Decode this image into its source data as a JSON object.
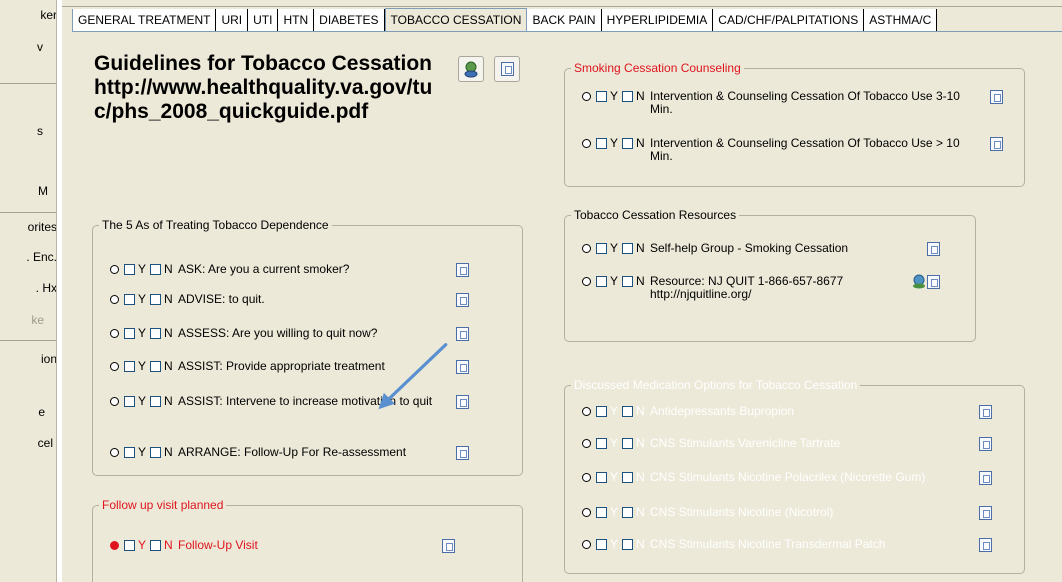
{
  "sidebar": {
    "items": [
      {
        "label": "ker",
        "disabled": false
      },
      {
        "label": "v",
        "disabled": false
      },
      {
        "label": "s",
        "disabled": false
      },
      {
        "label": "M",
        "disabled": false
      },
      {
        "label": "orites",
        "disabled": false
      },
      {
        "label": ". Enc.",
        "disabled": false
      },
      {
        "label": ". Hx",
        "disabled": false
      },
      {
        "label": "ke",
        "disabled": true
      },
      {
        "label": "ion",
        "disabled": false
      },
      {
        "label": "e",
        "disabled": false
      },
      {
        "label": "cel",
        "disabled": false
      }
    ]
  },
  "tabs": [
    {
      "label": "GENERAL TREATMENT",
      "active": false
    },
    {
      "label": "URI",
      "active": false
    },
    {
      "label": "UTI",
      "active": false
    },
    {
      "label": "HTN",
      "active": false
    },
    {
      "label": "DIABETES",
      "active": false
    },
    {
      "label": "TOBACCO CESSATION",
      "active": true
    },
    {
      "label": "BACK PAIN",
      "active": false
    },
    {
      "label": "HYPERLIPIDEMIA",
      "active": false
    },
    {
      "label": "CAD/CHF/PALPITATIONS",
      "active": false
    },
    {
      "label": "ASTHMA/C",
      "active": false
    }
  ],
  "title": "Guidelines for Tobacco Cessation http://www.healthquality.va.gov/tuc/phs_2008_quickguide.pdf",
  "yes_label": "Y",
  "no_label": "N",
  "five_as": {
    "legend": "The 5 As of Treating Tobacco Dependence",
    "items": [
      "ASK: Are you a current smoker?",
      "ADVISE: to quit.",
      "ASSESS: Are you willing to quit now?",
      "ASSIST: Provide appropriate treatment",
      "ASSIST: Intervene to increase motivation to quit",
      "ARRANGE: Follow-Up For Re-assessment"
    ]
  },
  "followup": {
    "legend": "Follow up visit planned",
    "item": "Follow-Up Visit"
  },
  "counseling": {
    "legend": "Smoking Cessation Counseling",
    "items": [
      "Intervention & Counseling Cessation Of Tobacco Use 3-10 Min.",
      "Intervention & Counseling Cessation Of Tobacco Use > 10 Min."
    ]
  },
  "resources": {
    "legend": "Tobacco Cessation Resources",
    "items": [
      "Self-help Group - Smoking Cessation",
      "Resource: NJ QUIT 1-866-657-8677 http://njquitline.org/"
    ]
  },
  "medications": {
    "legend": "Discussed Medication Options for Tobacco Cessation",
    "items": [
      "Antidepressants Bupropion",
      "CNS Stimulants Varenicline Tartrate",
      "CNS Stimulants Nicotine Polacrilex (Nicorette Gum)",
      "CNS Stimulants Nicotine (Nicotrol)",
      "CNS Stimulants Nicotine Transdermal Patch"
    ]
  },
  "colors": {
    "panel": "#ece9d8",
    "accent_red": "#e0141e",
    "arrow": "#5a8fd0"
  }
}
